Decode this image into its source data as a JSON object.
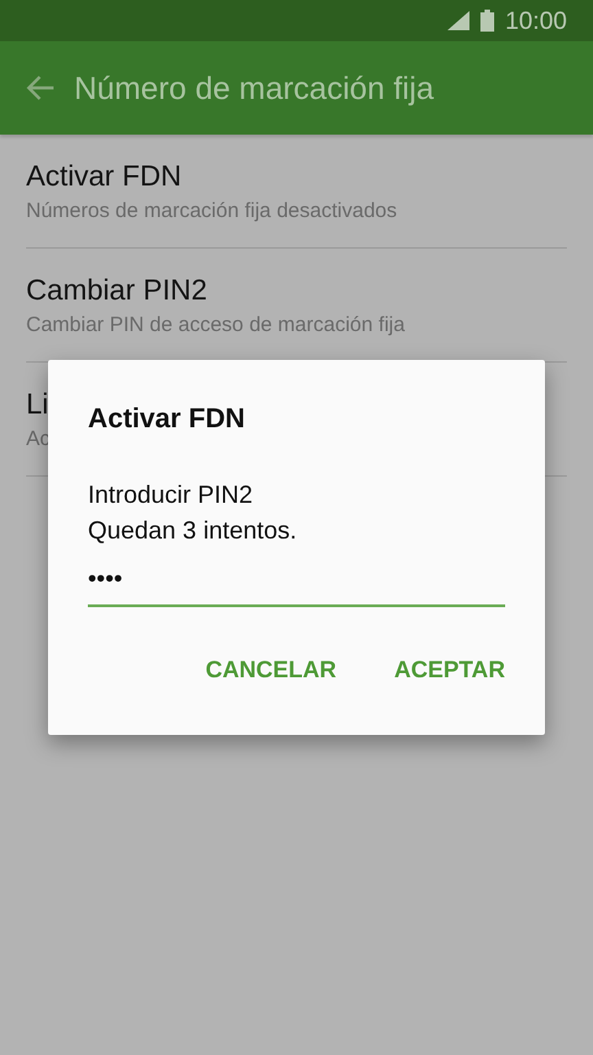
{
  "status_bar": {
    "time": "10:00"
  },
  "app_bar": {
    "title": "Número de marcación fija"
  },
  "settings": [
    {
      "title": "Activar FDN",
      "subtitle": "Números de marcación fija desactivados"
    },
    {
      "title": "Cambiar PIN2",
      "subtitle": "Cambiar PIN de acceso de marcación fija"
    },
    {
      "title": "Li",
      "subtitle": "Ac"
    }
  ],
  "dialog": {
    "title": "Activar FDN",
    "message": [
      "Introducir PIN2",
      "Quedan 3 intentos."
    ],
    "field": {
      "value": "••••"
    },
    "buttons": [
      {
        "label": "CANCELAR"
      },
      {
        "label": "ACEPTAR"
      }
    ]
  }
}
